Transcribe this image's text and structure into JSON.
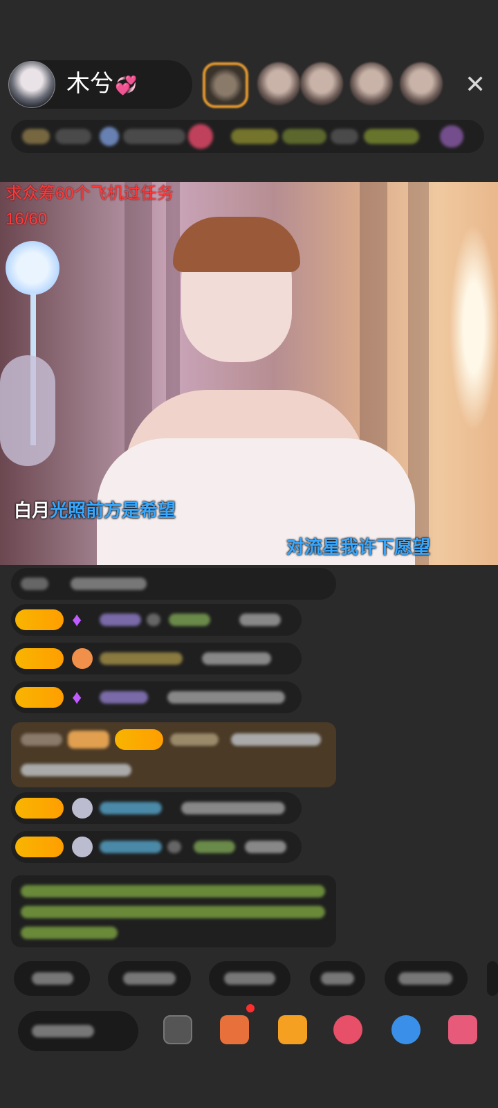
{
  "header": {
    "host_name": "木兮",
    "host_hearts": "💞",
    "close_glyph": "✕"
  },
  "video": {
    "task_text": "求众筹60个飞机过任务",
    "task_progress": "16/60",
    "lyric_left": {
      "white": "白月",
      "blue": "光照前方是希望"
    },
    "lyric_right": {
      "blue": "对流星我许下愿望"
    }
  },
  "icons": {
    "avatar": "host-avatar",
    "close": "close-icon",
    "gem": "purple-gem-icon",
    "more": "more-icon",
    "gift": "gift-icon"
  },
  "colors": {
    "accent_gold": "#f8b500",
    "task_red": "#ff3a3a",
    "lyric_blue": "#38a8ff",
    "gem_purple": "#c05cff"
  }
}
